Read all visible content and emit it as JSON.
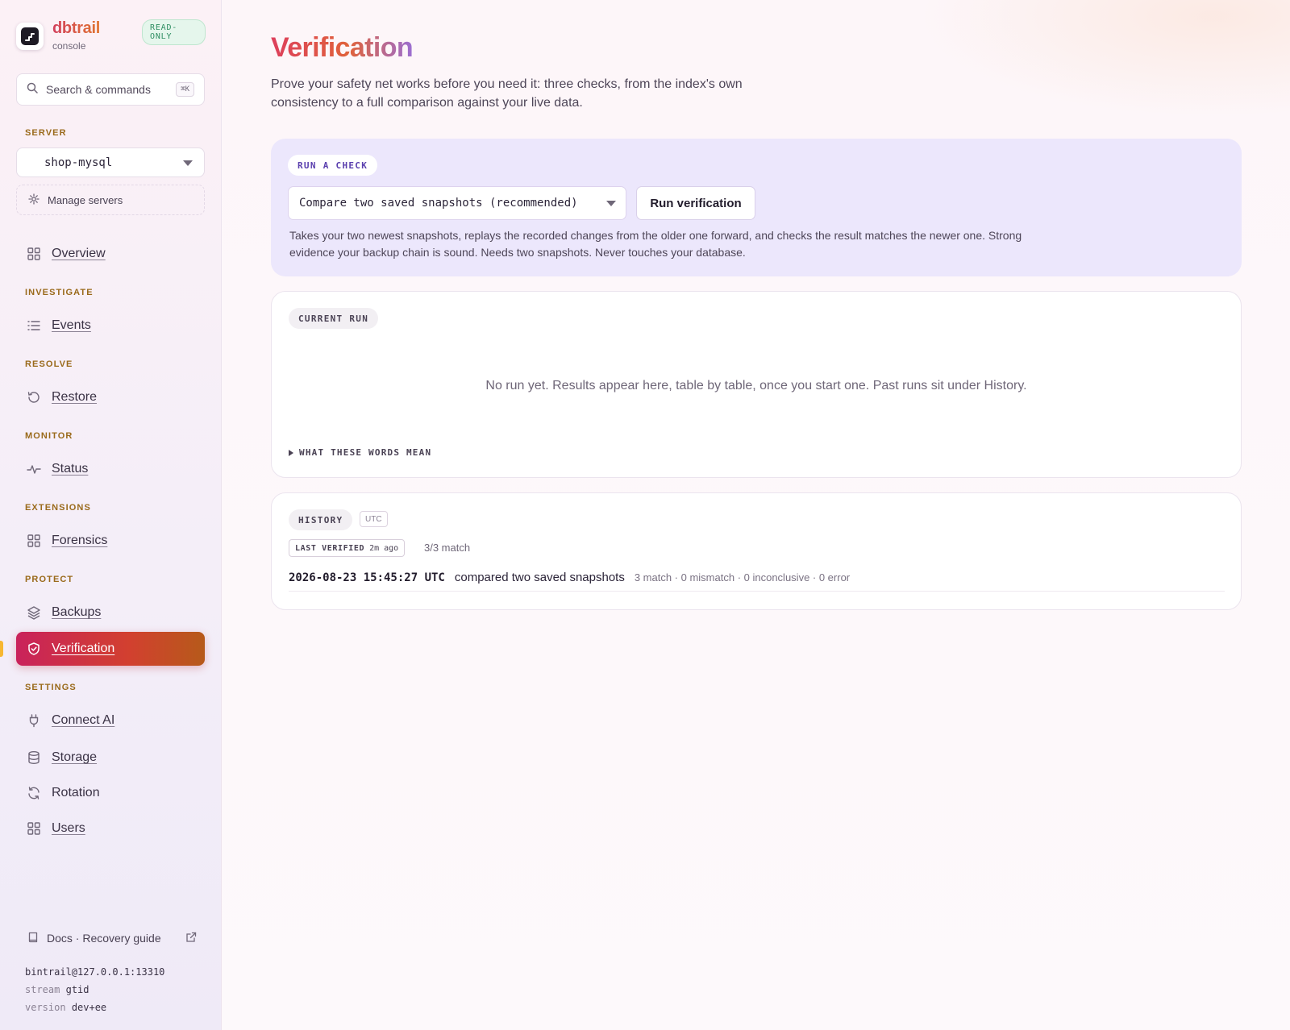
{
  "app": {
    "name": "dbtrail",
    "subtitle": "console",
    "mode_badge": "READ-ONLY"
  },
  "colors": {
    "accent": "#d2405c",
    "accent_warm": "#e0742f",
    "read_only_badge": "#2f8e62",
    "section_label": "#9a6a1b",
    "run_card_bg": "#ece7fc"
  },
  "sidebar": {
    "search": {
      "label": "Search & commands",
      "shortcut": "⌘K",
      "icon": "search-icon"
    },
    "server_section": {
      "label": "SERVER",
      "selected": "shop-mysql",
      "manage_label": "Manage servers"
    },
    "overview": {
      "label": "Overview",
      "icon": "grid-icon"
    },
    "sections": {
      "investigate": "INVESTIGATE",
      "resolve": "RESOLVE",
      "monitor": "MONITOR",
      "extensions": "EXTENSIONS",
      "protect": "PROTECT",
      "settings": "SETTINGS"
    },
    "items": {
      "events": {
        "label": "Events",
        "icon": "list-icon"
      },
      "restore": {
        "label": "Restore",
        "icon": "history-icon"
      },
      "status": {
        "label": "Status",
        "icon": "pulse-icon"
      },
      "forensics": {
        "label": "Forensics",
        "icon": "grid-icon"
      },
      "backups": {
        "label": "Backups",
        "icon": "layers-icon"
      },
      "verification": {
        "label": "Verification",
        "icon": "shield-check-icon",
        "active": true
      },
      "connect_ai": {
        "label": "Connect AI",
        "icon": "plug-icon"
      },
      "storage": {
        "label": "Storage",
        "icon": "database-icon"
      },
      "rotation": {
        "label": "Rotation",
        "icon": "refresh-icon"
      },
      "users": {
        "label": "Users",
        "icon": "grid-icon"
      }
    },
    "docs_label": "Docs · Recovery guide",
    "footer": {
      "connection": "bintrail@127.0.0.1:13310",
      "stream_key": "stream",
      "stream_value": "gtid",
      "version_key": "version",
      "version_value": "dev+ee"
    }
  },
  "main": {
    "title": "Verification",
    "description": "Prove your safety net works before you need it: three checks, from the index's own consistency to a full comparison against your live data.",
    "run_card": {
      "pill": "RUN A CHECK",
      "selected_check": "Compare two saved snapshots (recommended)",
      "run_button": "Run verification",
      "description": "Takes your two newest snapshots, replays the recorded changes from the older one forward, and checks the result matches the newer one. Strong evidence your backup chain is sound. Needs two snapshots. Never touches your database."
    },
    "current_run": {
      "pill": "CURRENT RUN",
      "empty_message": "No run yet. Results appear here, table by table, once you start one. Past runs sit under History.",
      "glossary_toggle": "WHAT THESE WORDS MEAN"
    },
    "history": {
      "pill": "HISTORY",
      "tz_tag": "UTC",
      "last_verified_label": "LAST VERIFIED",
      "last_verified_age": "2m ago",
      "match_summary": "3/3 match",
      "rows": [
        {
          "timestamp": "2026-08-23 15:45:27 UTC",
          "kind": "compared two saved snapshots",
          "counts": "3 match · 0 mismatch · 0 inconclusive · 0 error"
        }
      ]
    }
  }
}
